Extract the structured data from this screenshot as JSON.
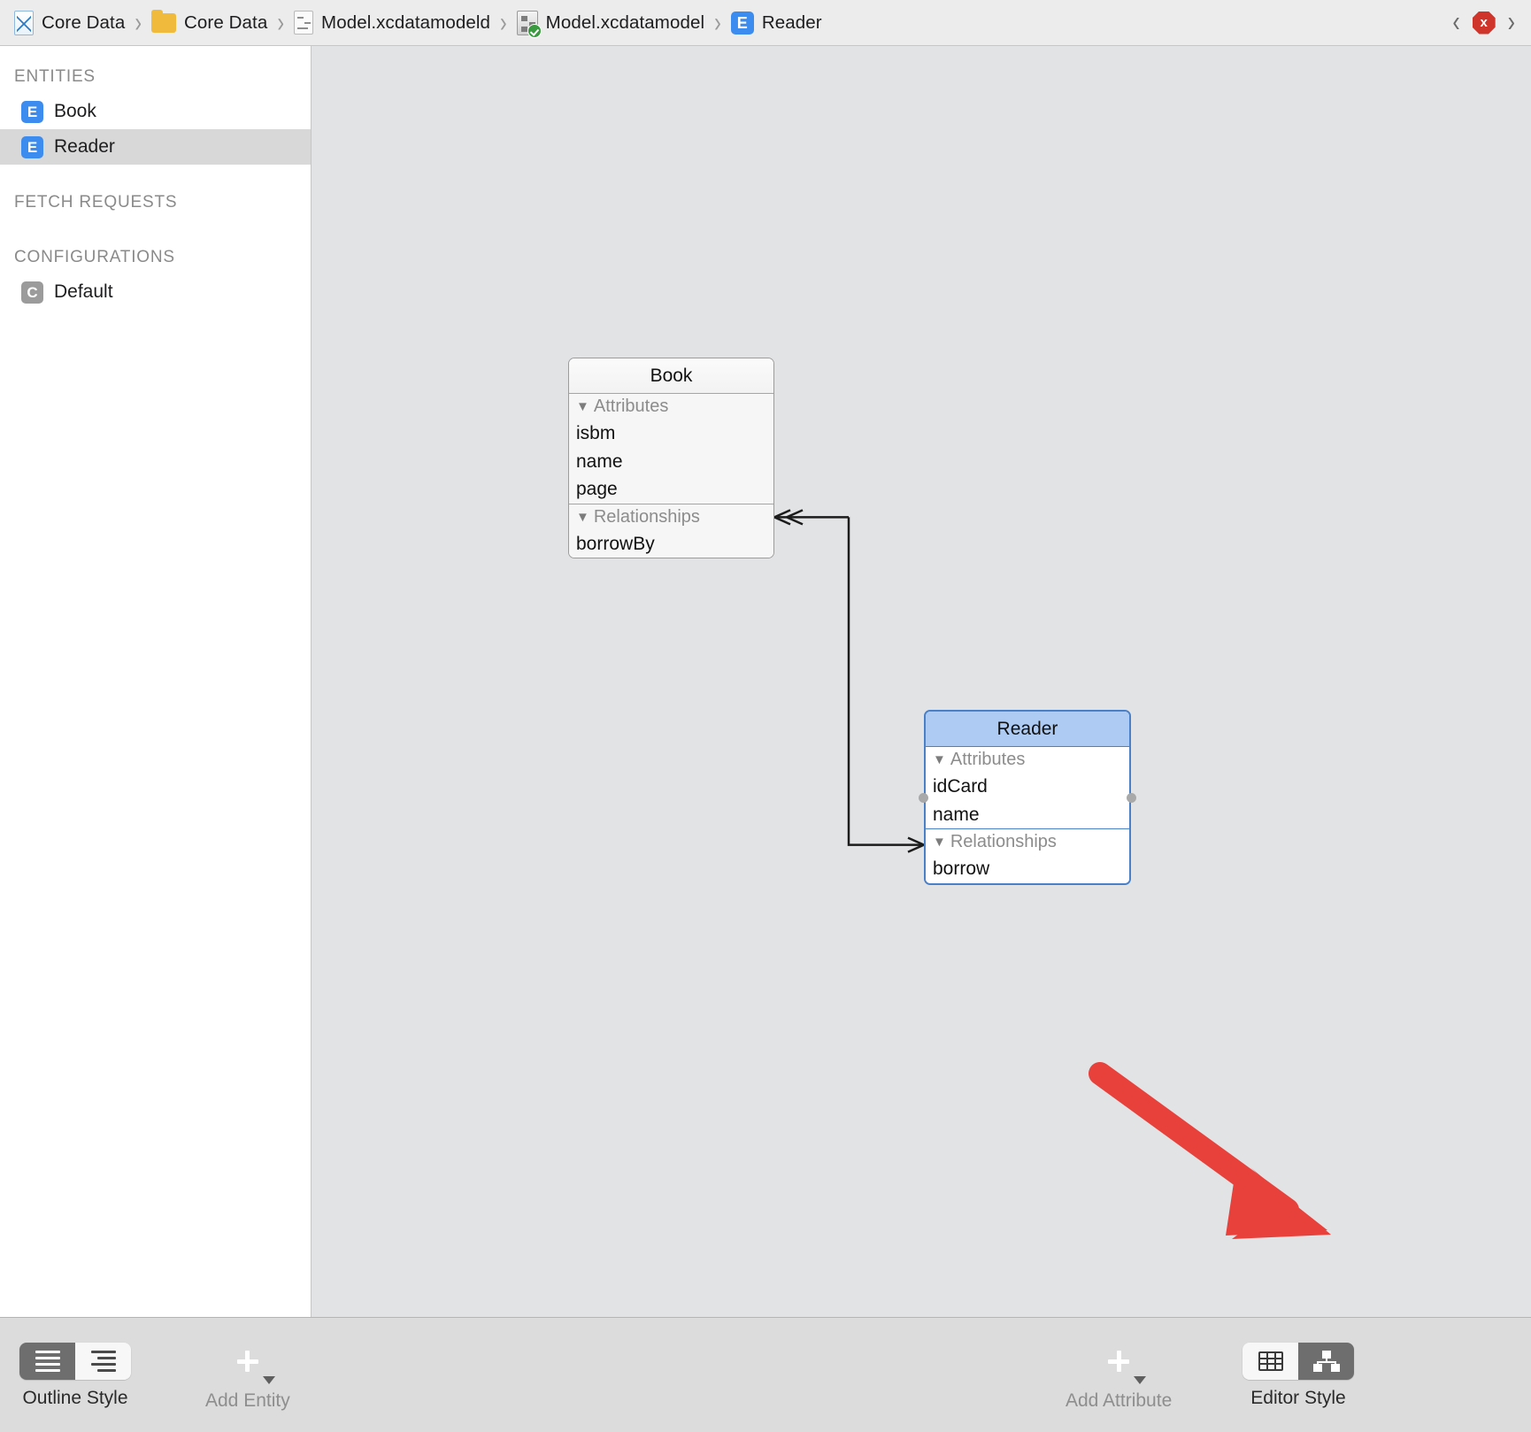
{
  "breadcrumb": {
    "items": [
      {
        "label": "Core Data",
        "icon": "xcode-project-icon"
      },
      {
        "label": "Core Data",
        "icon": "folder-icon"
      },
      {
        "label": "Model.xcdatamodeld",
        "icon": "datamodel-bundle-icon"
      },
      {
        "label": "Model.xcdatamodel",
        "icon": "datamodel-version-icon"
      },
      {
        "label": "Reader",
        "icon": "entity-icon"
      }
    ],
    "separator": "›",
    "nav_back": "‹",
    "nav_forward": "›",
    "error_badge": "x"
  },
  "sidebar": {
    "sections": [
      {
        "title": "ENTITIES",
        "items": [
          {
            "label": "Book",
            "icon": "entity-icon",
            "selected": false
          },
          {
            "label": "Reader",
            "icon": "entity-icon",
            "selected": true
          }
        ]
      },
      {
        "title": "FETCH REQUESTS",
        "items": []
      },
      {
        "title": "CONFIGURATIONS",
        "items": [
          {
            "label": "Default",
            "icon": "configuration-icon",
            "selected": false
          }
        ]
      }
    ]
  },
  "canvas": {
    "entities": [
      {
        "name": "Book",
        "selected": false,
        "attributes_label": "Attributes",
        "attributes": [
          "isbm",
          "name",
          "page"
        ],
        "relationships_label": "Relationships",
        "relationships": [
          "borrowBy"
        ]
      },
      {
        "name": "Reader",
        "selected": true,
        "attributes_label": "Attributes",
        "attributes": [
          "idCard",
          "name"
        ],
        "relationships_label": "Relationships",
        "relationships": [
          "borrow"
        ]
      }
    ],
    "disclosure_triangle": "▼"
  },
  "toolbar": {
    "outline_style_label": "Outline Style",
    "add_entity_label": "Add Entity",
    "add_attribute_label": "Add Attribute",
    "editor_style_label": "Editor Style"
  },
  "colors": {
    "accent_blue": "#3c8cf0",
    "selection_header": "#aecbf3",
    "selection_border": "#4a80c8",
    "annotation_red": "#e8413c",
    "error_red": "#d0352b",
    "canvas_bg": "#e2e3e5",
    "toolbar_bg": "#dcdcdc"
  }
}
